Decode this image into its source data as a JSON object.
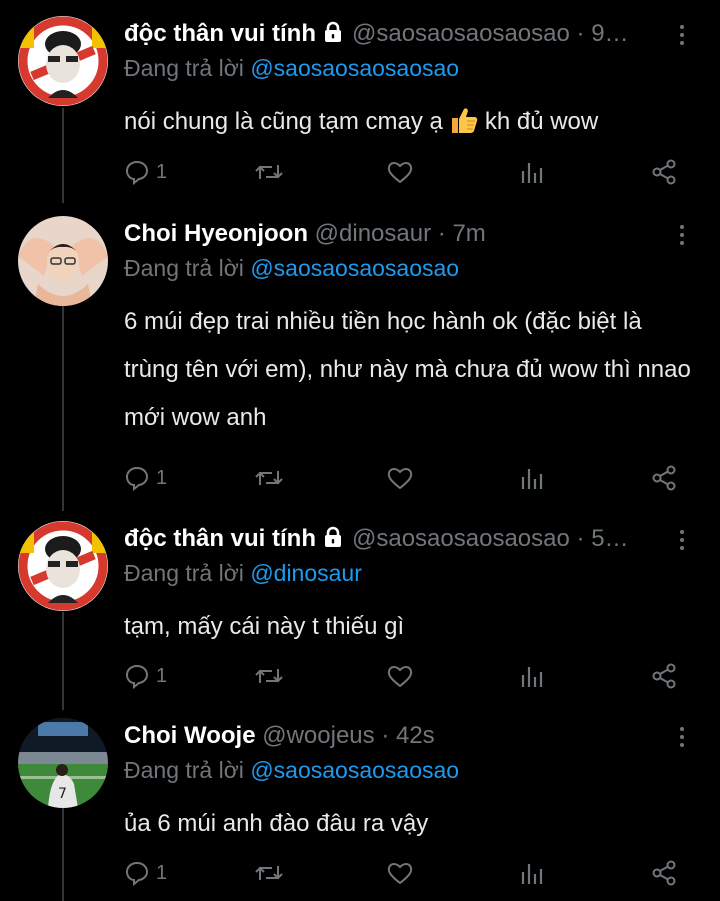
{
  "tweets": [
    {
      "name": "độc thân vui tính",
      "protected": true,
      "handle": "@saosaosaosaosao",
      "time_sep": "·",
      "time": "9…",
      "reply_prefix": "Đang trả lời",
      "reply_to": "@saosaosaosaosao",
      "text_before": "nói chung là cũng tạm cmay ạ",
      "emoji": "thumbs-up",
      "text_after": "kh đủ wow",
      "reply_count": "1"
    },
    {
      "name": "Choi Hyeonjoon",
      "protected": false,
      "handle": "@dinosaur",
      "time_sep": "·",
      "time": "7m",
      "reply_prefix": "Đang trả lời",
      "reply_to": "@saosaosaosaosao",
      "text": "6 múi đẹp trai nhiều tiền học hành ok (đặc biệt là trùng tên với em), như này mà chưa đủ wow thì nnao mới wow anh",
      "reply_count": "1"
    },
    {
      "name": "độc thân vui tính",
      "protected": true,
      "handle": "@saosaosaosaosao",
      "time_sep": "·",
      "time": "5…",
      "reply_prefix": "Đang trả lời",
      "reply_to": "@dinosaur",
      "text": "tạm, mấy cái này t thiếu gì",
      "reply_count": "1"
    },
    {
      "name": "Choi Wooje",
      "protected": false,
      "handle": "@woojeus",
      "time_sep": "·",
      "time": "42s",
      "reply_prefix": "Đang trả lời",
      "reply_to": "@saosaosaosaosao",
      "text": "ủa 6 múi anh đào đâu ra vậy",
      "reply_count": "1"
    }
  ],
  "colors": {
    "background": "#000000",
    "name": "#ffffff",
    "secondary": "#71767b",
    "link": "#1d9bf0",
    "body": "#e7e9ea"
  },
  "icons": [
    "lock-icon",
    "more-icon",
    "reply-icon",
    "retweet-icon",
    "like-icon",
    "views-icon",
    "share-icon",
    "thumbs-up-emoji"
  ]
}
